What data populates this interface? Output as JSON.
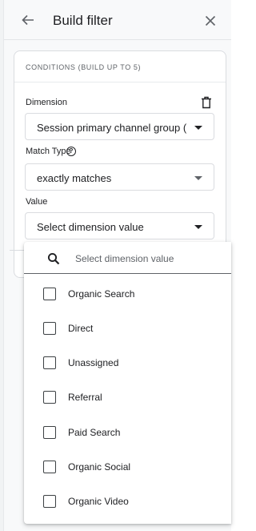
{
  "header": {
    "title": "Build filter",
    "back_icon": "arrow-left-icon",
    "close_icon": "close-icon"
  },
  "conditions": {
    "heading": "CONDITIONS (BUILD UP TO 5)",
    "dimension": {
      "label": "Dimension",
      "value": "Session primary channel group ("
    },
    "match_type": {
      "label": "Match Type",
      "value": "exactly matches"
    },
    "value": {
      "label": "Value",
      "value": "Select dimension value"
    }
  },
  "dropdown": {
    "search_placeholder": "Select dimension value",
    "options": [
      {
        "label": "Organic Search",
        "checked": false
      },
      {
        "label": "Direct",
        "checked": false
      },
      {
        "label": "Unassigned",
        "checked": false
      },
      {
        "label": "Referral",
        "checked": false
      },
      {
        "label": "Paid Search",
        "checked": false
      },
      {
        "label": "Organic Social",
        "checked": false
      },
      {
        "label": "Organic Video",
        "checked": false
      }
    ]
  }
}
